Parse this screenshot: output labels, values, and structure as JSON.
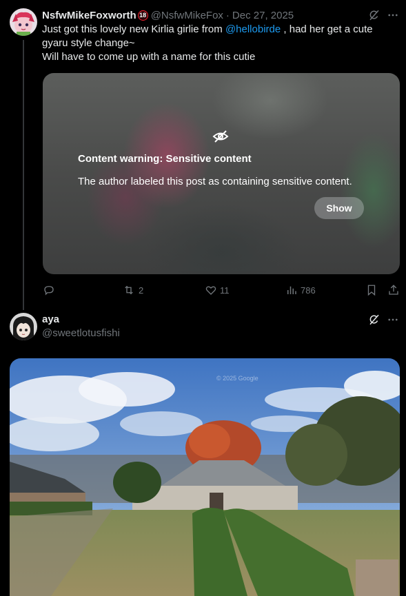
{
  "post1": {
    "display_name": "NsfwMikeFoxworth",
    "badge": "18",
    "handle": "@NsfwMikeFox",
    "separator": "·",
    "date": "Dec 27, 2025",
    "text_before_mention": "Just got this lovely new Kirlia girlie from ",
    "mention": "@hellobirde",
    "text_after_mention": " , had her get a cute gyaru style change~",
    "text_line2": "Will have to come up with a name for this cutie",
    "warning": {
      "title": "Content warning: Sensitive content",
      "body": "The author labeled this post as containing sensitive content.",
      "show_label": "Show"
    },
    "actions": {
      "reposts": "2",
      "likes": "11",
      "views": "786"
    }
  },
  "post2": {
    "display_name": "aya",
    "handle": "@sweetlotusfishi",
    "watermark": "© 2025 Google"
  },
  "icons": {
    "grok": "grok-icon",
    "more": "more-icon",
    "hidden": "eye-slash-icon",
    "reply": "reply-icon",
    "repost": "repost-icon",
    "like": "heart-icon",
    "views": "views-icon",
    "bookmark": "bookmark-icon",
    "share": "share-icon"
  },
  "colors": {
    "background": "#000000",
    "text": "#e7e9ea",
    "muted": "#71767b",
    "link": "#1d9bf0",
    "badge": "#f4212e"
  }
}
